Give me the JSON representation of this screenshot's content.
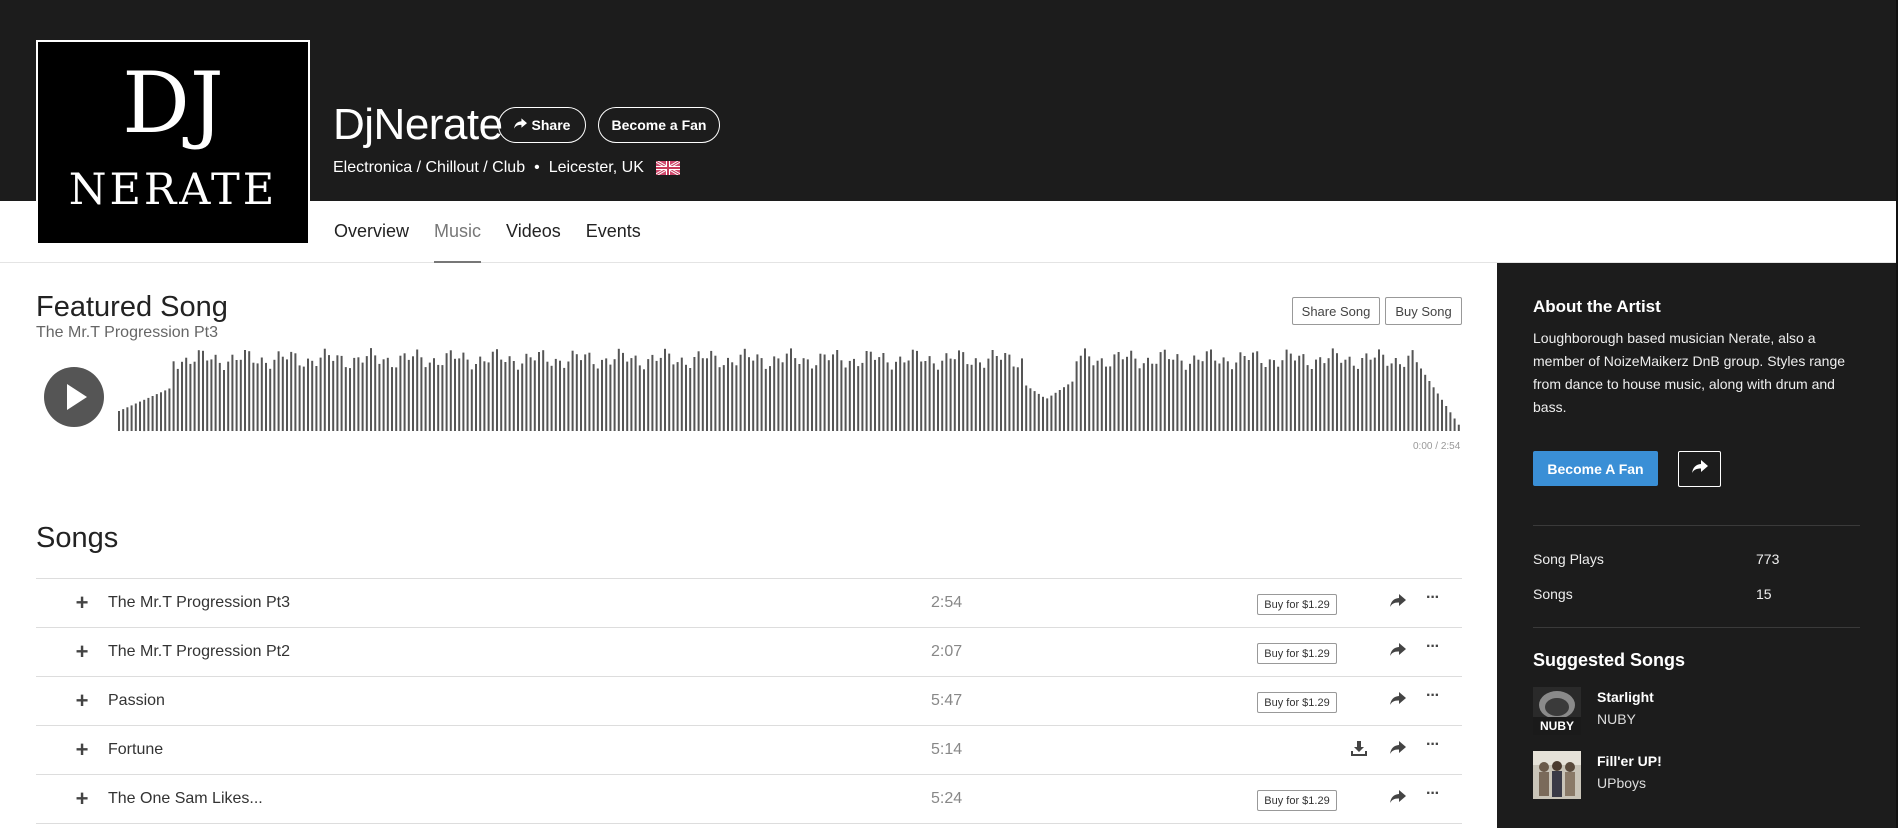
{
  "artist": {
    "name": "DjNerate",
    "logo_text_line1": "DJ",
    "logo_text_line2": "NERATE",
    "genres": "Electronica / Chillout / Club",
    "location": "Leicester, UK",
    "share_label": "Share",
    "become_fan_label": "Become a Fan"
  },
  "tabs": [
    {
      "label": "Overview",
      "active": false
    },
    {
      "label": "Music",
      "active": true
    },
    {
      "label": "Videos",
      "active": false
    },
    {
      "label": "Events",
      "active": false
    }
  ],
  "featured": {
    "heading": "Featured Song",
    "song_title": "The Mr.T Progression Pt3",
    "share_song_label": "Share Song",
    "buy_song_label": "Buy Song",
    "time_current": "0:00",
    "time_separator": "/",
    "time_total": "2:54"
  },
  "songs": {
    "heading": "Songs",
    "items": [
      {
        "title": "The Mr.T Progression Pt3",
        "duration": "2:54",
        "buy_label": "Buy for $1.29",
        "download": false
      },
      {
        "title": "The Mr.T Progression Pt2",
        "duration": "2:07",
        "buy_label": "Buy for $1.29",
        "download": false
      },
      {
        "title": "Passion",
        "duration": "5:47",
        "buy_label": "Buy for $1.29",
        "download": false
      },
      {
        "title": "Fortune",
        "duration": "5:14",
        "buy_label": "",
        "download": true
      },
      {
        "title": "The One Sam Likes...",
        "duration": "5:24",
        "buy_label": "Buy for $1.29",
        "download": false
      }
    ]
  },
  "sidebar": {
    "about_title": "About the Artist",
    "about_text": "Loughborough based musician Nerate, also a member of NoizeMaikerz DnB group. Styles range from dance to house music, along with drum and bass.",
    "become_fan_label": "Become A Fan",
    "stats": [
      {
        "label": "Song Plays",
        "value": "773"
      },
      {
        "label": "Songs",
        "value": "15"
      }
    ],
    "suggested_title": "Suggested Songs",
    "suggested": [
      {
        "song": "Starlight",
        "artist": "NUBY",
        "thumb_text": "NUBY"
      },
      {
        "song": "Fill'er UP!",
        "artist": "UPboys"
      }
    ]
  },
  "icons": {
    "share": "share-arrow-icon",
    "play": "play-icon",
    "plus": "plus-icon",
    "download": "download-icon",
    "more": "more-dots-icon",
    "flag": "uk-flag-icon"
  },
  "colors": {
    "header_bg": "#1c1c1c",
    "accent_blue": "#3a8fd6",
    "waveform": "#555555"
  }
}
